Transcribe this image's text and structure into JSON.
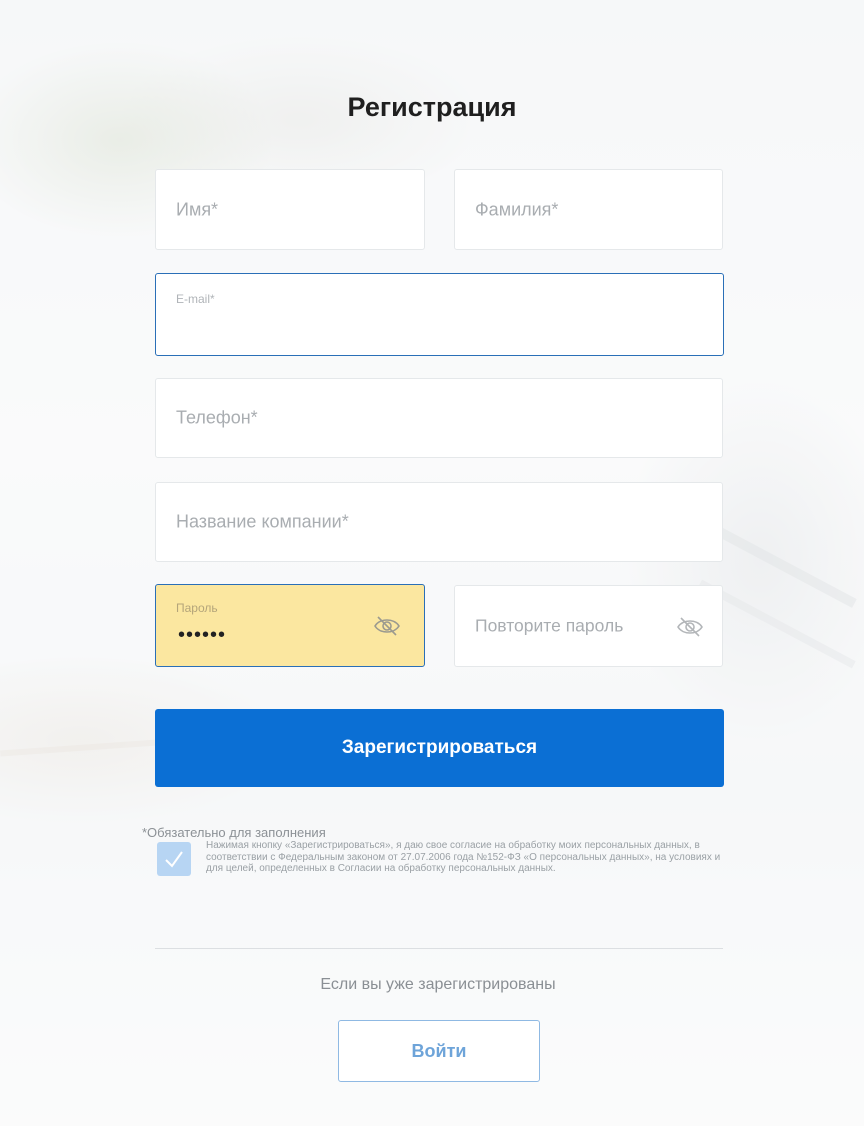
{
  "form": {
    "title": "Регистрация",
    "first_name": {
      "placeholder": "Имя*",
      "value": ""
    },
    "last_name": {
      "placeholder": "Фамилия*",
      "value": ""
    },
    "email": {
      "label": "E-mail*",
      "value": ""
    },
    "phone": {
      "placeholder": "Телефон*",
      "value": ""
    },
    "company": {
      "placeholder": "Название компании*",
      "value": ""
    },
    "password": {
      "label": "Пароль",
      "value_masked": "••••••",
      "toggle_icon": "eye-off-icon"
    },
    "password_repeat": {
      "placeholder": "Повторите пароль",
      "toggle_icon": "eye-off-icon"
    },
    "submit_label": "Зарегистрироваться",
    "required_note": "*Обязательно для заполнения",
    "consent": {
      "checked": true,
      "text": "Нажимая кнопку «Зарегистрироваться», я даю свое согласие на обработку моих персональных данных, в соответствии с Федеральным законом от 27.07.2006 года №152-ФЗ «О персональных данных», на условиях и для целей, определенных в Согласии на обработку персональных данных."
    },
    "already_registered": "Если вы уже зарегистрированы",
    "login_label": "Войти"
  },
  "colors": {
    "primary": "#0b6fd4",
    "autofill": "#fbe7a0",
    "focus_border": "#2a6fb7",
    "checkbox": "#b7d5f3"
  }
}
